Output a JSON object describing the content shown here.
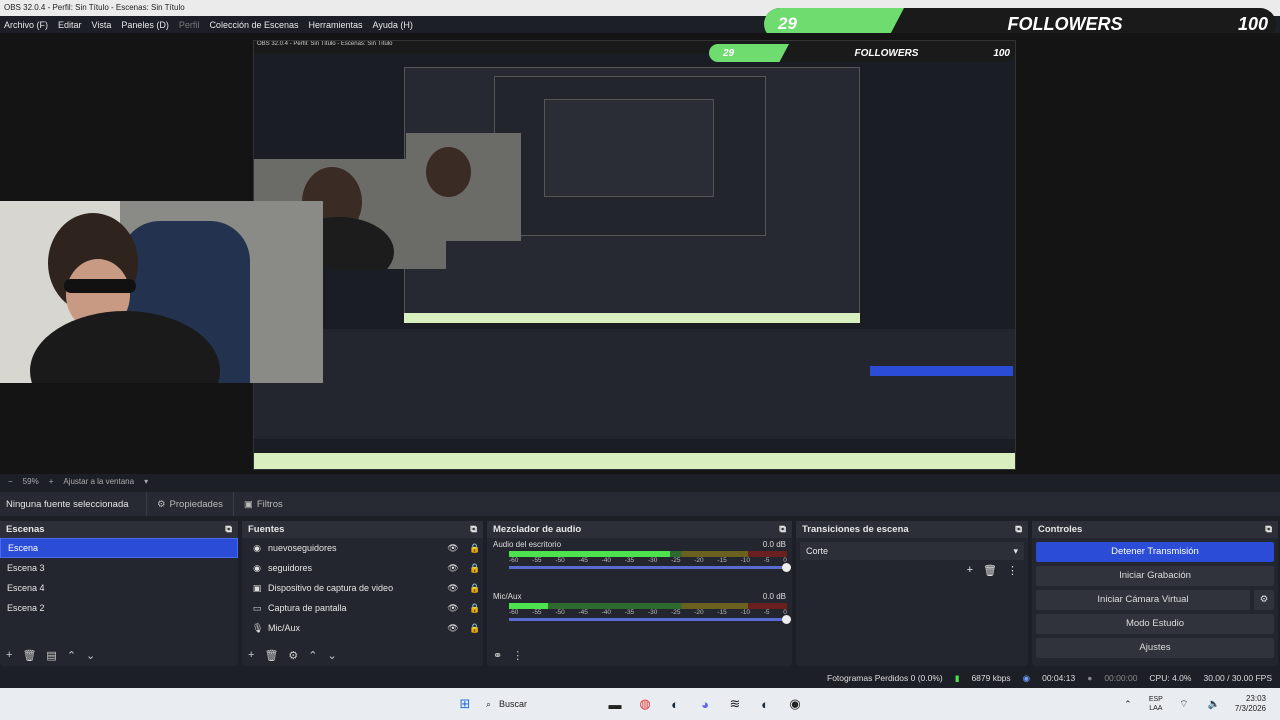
{
  "window": {
    "title": "OBS 32.0.4 - Perfil: Sin Título - Escenas: Sin Título"
  },
  "menu": [
    "Archivo (F)",
    "Editar",
    "Vista",
    "Paneles (D)",
    "Perfil",
    "Colección de Escenas",
    "Herramientas",
    "Ayuda (H)"
  ],
  "followers": {
    "current": "29",
    "label": "FOLLOWERS",
    "goal": "100",
    "progress": 0.29
  },
  "preview": {
    "zoom": "59%",
    "fit": "Ajustar a la ventana"
  },
  "source_toolbar": {
    "none_selected": "Ninguna fuente seleccionada",
    "properties": "Propiedades",
    "filters": "Filtros"
  },
  "scenes": {
    "title": "Escenas",
    "items": [
      "Escena",
      "Escena 3",
      "Escena 4",
      "Escena 2"
    ]
  },
  "sources": {
    "title": "Fuentes",
    "items": [
      {
        "label": "nuevoseguidores",
        "icon": "image-icon"
      },
      {
        "label": "seguidores",
        "icon": "image-icon"
      },
      {
        "label": "Dispositivo de captura de video",
        "icon": "camera-icon"
      },
      {
        "label": "Captura de pantalla",
        "icon": "monitor-icon"
      },
      {
        "label": "Mic/Aux",
        "icon": "mic-icon"
      }
    ]
  },
  "mixer": {
    "title": "Mezclador de audio",
    "channels": [
      {
        "name": "Audio del escritorio",
        "db": "0.0 dB",
        "level": 0.58
      },
      {
        "name": "Mic/Aux",
        "db": "0.0 dB",
        "level": 0.14
      }
    ],
    "scale": [
      "-60",
      "-55",
      "-50",
      "-45",
      "-40",
      "-35",
      "-30",
      "-25",
      "-20",
      "-15",
      "-10",
      "-5",
      "0"
    ]
  },
  "transitions": {
    "title": "Transiciones de escena",
    "selected": "Corte"
  },
  "controls": {
    "title": "Controles",
    "buttons": [
      "Detener Transmisión",
      "Iniciar Grabación",
      "Iniciar Cámara Virtual",
      "Modo Estudio",
      "Ajustes"
    ]
  },
  "status": {
    "dropped": "Fotogramas Perdidos 0 (0.0%)",
    "bitrate": "6879 kbps",
    "stream_time": "00:04:13",
    "rec_time": "00:00:00",
    "cpu": "CPU: 4.0%",
    "fps": "30.00 / 30.00 FPS"
  },
  "taskbar": {
    "search": "Buscar",
    "lang": "ESP",
    "lang2": "LAA",
    "time": "23:03",
    "date": "7/3/2026"
  },
  "colors": {
    "accent": "#2a4cd6",
    "bg": "#1d1f26",
    "green": "#6fdc6f"
  }
}
